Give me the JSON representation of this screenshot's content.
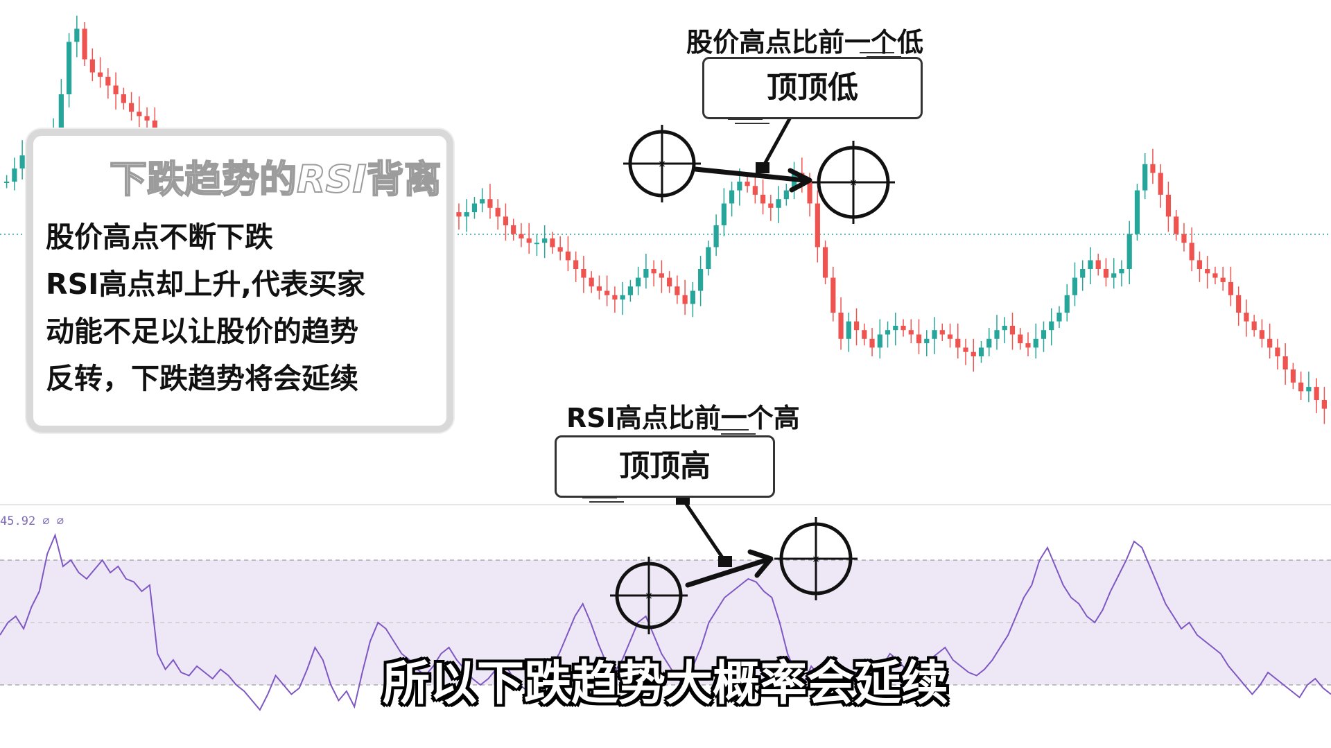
{
  "info_box": {
    "title_prefix": "下跌趋势的",
    "title_rsi": "RSI",
    "title_suffix": "背离",
    "lines": [
      "股价高点不断下跌",
      "RSI高点却上升,代表买家",
      "动能不足以让股价的趋势",
      "反转，下跌趋势将会延续"
    ]
  },
  "price_annotation": {
    "label": "股价高点比前一个低",
    "badge": "顶顶低"
  },
  "rsi_annotation": {
    "label": "RSI高点比前一个高",
    "badge": "顶顶高"
  },
  "rsi_readout": "45.92 ∅ ∅",
  "subtitle": "所以下跌趋势大概率会延续",
  "colors": {
    "up": "#26a69a",
    "down": "#ef5350",
    "rsi_line": "#7e57c2",
    "rsi_band": "#ede7f6",
    "accent_dark": "#111111"
  },
  "chart_data": [
    {
      "type": "candlestick",
      "series": "price",
      "trend": "downtrend with lower highs",
      "grid": false,
      "values": [
        60,
        63,
        66,
        64,
        68,
        70,
        72,
        80,
        92,
        95,
        88,
        85,
        84,
        82,
        80,
        78,
        76,
        75,
        74,
        70,
        68,
        66,
        64,
        63,
        65,
        66,
        64,
        63,
        62,
        60,
        58,
        57,
        56,
        55,
        57,
        59,
        58,
        56,
        54,
        52,
        48,
        46,
        44,
        42,
        40,
        39,
        41,
        44,
        47,
        49,
        52,
        56,
        58,
        60,
        59,
        57,
        55,
        53,
        52,
        53,
        55,
        56,
        54,
        52,
        50,
        48,
        47,
        46,
        46,
        47,
        45,
        44,
        42,
        40,
        38,
        36,
        35,
        34,
        33,
        34,
        36,
        38,
        40,
        39,
        38,
        36,
        34,
        32,
        35,
        40,
        45,
        50,
        55,
        58,
        60,
        59,
        57,
        55,
        54,
        56,
        58,
        62,
        60,
        55,
        45,
        38,
        30,
        24,
        28,
        26,
        24,
        22,
        25,
        26,
        27,
        26,
        25,
        23,
        24,
        26,
        25,
        24,
        22,
        21,
        20,
        22,
        24,
        26,
        27,
        25,
        23,
        22,
        24,
        26,
        28,
        30,
        34,
        38,
        40,
        42,
        40,
        38,
        39,
        40,
        48,
        58,
        64,
        62,
        57,
        52,
        48,
        46,
        42,
        40,
        39,
        38,
        37,
        34,
        30,
        28,
        26,
        24,
        22,
        20,
        17,
        14,
        12,
        13,
        10,
        8
      ]
    },
    {
      "type": "line",
      "series": "RSI",
      "ylim": [
        0,
        100
      ],
      "levels": [
        70,
        50,
        30
      ],
      "values": [
        46,
        50,
        52,
        48,
        55,
        60,
        72,
        78,
        68,
        70,
        66,
        64,
        67,
        70,
        66,
        68,
        64,
        63,
        60,
        62,
        40,
        35,
        38,
        34,
        33,
        36,
        34,
        32,
        35,
        33,
        30,
        28,
        25,
        22,
        27,
        33,
        30,
        27,
        29,
        35,
        42,
        38,
        30,
        25,
        28,
        23,
        34,
        44,
        50,
        48,
        44,
        40,
        38,
        35,
        33,
        36,
        40,
        42,
        38,
        35,
        32,
        30,
        32,
        35,
        37,
        33,
        30,
        28,
        32,
        34,
        36,
        40,
        46,
        52,
        56,
        50,
        43,
        37,
        34,
        38,
        44,
        50,
        52,
        46,
        40,
        36,
        32,
        30,
        36,
        42,
        50,
        54,
        58,
        60,
        62,
        64,
        63,
        60,
        58,
        50,
        40,
        34,
        30,
        36,
        33,
        35,
        32,
        34,
        31,
        30,
        33,
        32,
        36,
        40,
        38,
        35,
        33,
        36,
        38,
        40,
        42,
        38,
        36,
        34,
        33,
        35,
        38,
        42,
        46,
        52,
        58,
        62,
        70,
        74,
        68,
        62,
        58,
        56,
        52,
        50,
        54,
        60,
        65,
        70,
        76,
        74,
        68,
        62,
        56,
        52,
        48,
        50,
        46,
        44,
        42,
        40,
        36,
        33,
        30,
        27,
        30,
        34,
        32,
        30,
        28,
        26,
        30,
        32,
        29,
        27
      ]
    }
  ]
}
